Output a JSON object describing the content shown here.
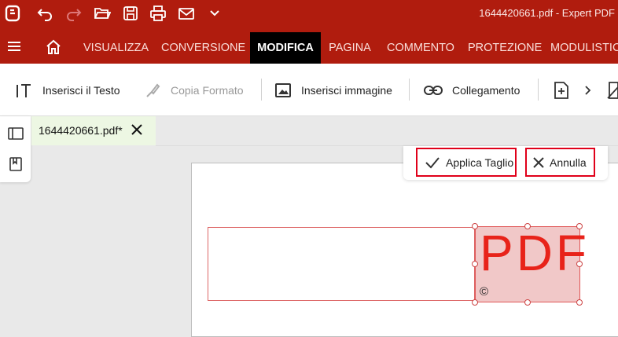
{
  "titlebar": {
    "app_title": "1644420661.pdf   -   Expert PDF",
    "icons": [
      "app-logo-icon",
      "undo-icon",
      "redo-icon",
      "open-folder-icon",
      "save-icon",
      "print-icon",
      "mail-icon",
      "chevron-down-icon"
    ]
  },
  "menu": {
    "tabs": [
      {
        "label": "VISUALIZZA"
      },
      {
        "label": "CONVERSIONE"
      },
      {
        "label": "MODIFICA",
        "active": true
      },
      {
        "label": "PAGINA"
      },
      {
        "label": "COMMENTO"
      },
      {
        "label": "PROTEZIONE"
      },
      {
        "label": "MODULISTICA"
      }
    ]
  },
  "toolbar": {
    "insert_text": "Inserisci il Testo",
    "copy_format": "Copia Formato",
    "insert_image": "Inserisci immagine",
    "link": "Collegamento"
  },
  "document_tab": {
    "filename": "1644420661.pdf*"
  },
  "crop": {
    "apply_label": "Applica Taglio",
    "cancel_label": "Annulla"
  },
  "logo": {
    "text": "PDF",
    "mark": "©"
  },
  "colors": {
    "brand_red": "#b01c0e",
    "highlight": "#e0001a",
    "tab_active": "#edf7e3"
  }
}
